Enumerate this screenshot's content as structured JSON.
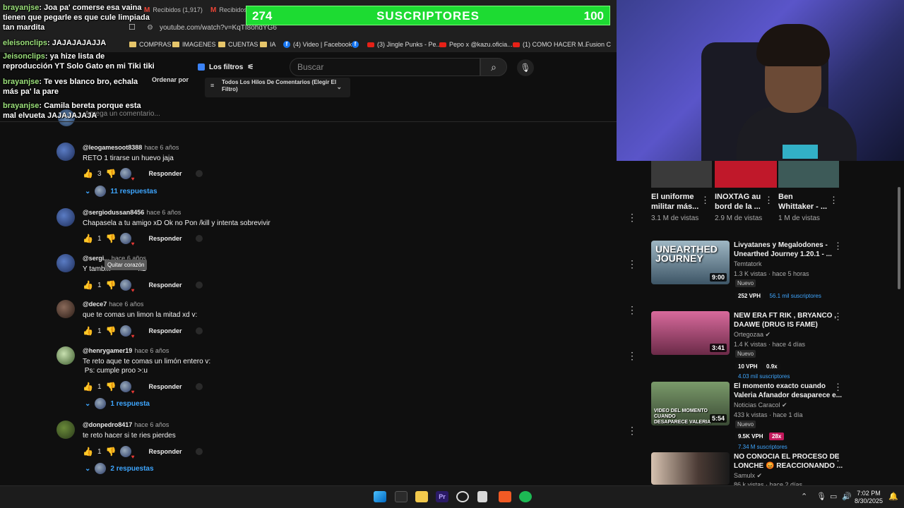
{
  "browser": {
    "tabs": [
      {
        "label": "Recibidos (1,917)"
      },
      {
        "label": "Recibidos"
      }
    ],
    "url": "youtube.com/watch?v=KqTI8ohdYG6",
    "bookmarks": [
      {
        "label": "COMPRAS",
        "icon": "folder-icon"
      },
      {
        "label": "IMAGENES",
        "icon": "folder-icon"
      },
      {
        "label": "CUENTAS",
        "icon": "folder-icon"
      },
      {
        "label": "IA",
        "icon": "folder-icon"
      },
      {
        "label": "(4) Video | Facebook",
        "icon": "facebook-icon"
      },
      {
        "label": "(3) Jingle Punks - Pe...",
        "icon": "youtube-icon"
      },
      {
        "label": "Pepo x @kazu.oficia...",
        "icon": "youtube-icon"
      },
      {
        "label": "(1) COMO HACER M...",
        "icon": "youtube-icon"
      },
      {
        "label": "Fusion C",
        "icon": "web-icon"
      }
    ]
  },
  "youtube": {
    "filters_label": "Los filtros",
    "search_placeholder": "Buscar",
    "sort_label": "Ordenar por",
    "threads_dropdown": "Todos Los Hilos De Comentarios (Elegir El Filtro)",
    "add_comment_placeholder": "Agrega un comentario...",
    "reply_label": "Responder",
    "tooltip": "Quitar corazón"
  },
  "comments": [
    {
      "user": "@leogamesoot8388",
      "time": "hace 6 años",
      "text": "RETO 1 tirarse un huevo jaja",
      "likes": "3",
      "replies": "11 respuestas"
    },
    {
      "user": "@sergiodussan8456",
      "time": "hace 6 años",
      "text": "Chapasela a tu amigo xD Ok no Pon /kill y intenta sobrevivir",
      "likes": "1",
      "replies": ""
    },
    {
      "user": "@sergi...",
      "time": "hace 6 años",
      "text": "Y tamb...              xD",
      "likes": "1",
      "replies": ""
    },
    {
      "user": "@dece7",
      "time": "hace 6 años",
      "text": "que te comas un limon la mitad xd v:",
      "likes": "1",
      "replies": ""
    },
    {
      "user": "@henrygamer19",
      "time": "hace 6 años",
      "text": "Te reto aque te comas un limón entero v:\n Ps: cumple proo >:u",
      "likes": "1",
      "replies": "1 respuesta"
    },
    {
      "user": "@donpedro8417",
      "time": "hace 6 años",
      "text": "te reto hacer si te ries pierdes",
      "likes": "1",
      "replies": "2 respuestas"
    }
  ],
  "chat": [
    {
      "user": "brayanjse",
      "text": "Joa pa' comerse esa vaina\ntienen que pegarle es que cule limpiada\ntan mardita"
    },
    {
      "user": "eleisonclips",
      "text": "JAJAJAJAJJA"
    },
    {
      "user": "Jeisonclips",
      "text": "ya hize lista de\nreproducción YT Solo Gato en mi Tiki tiki"
    },
    {
      "user": "brayanjse",
      "text": "Te ves blanco bro, echala"
    },
    {
      "user": "",
      "text": "más pa' la pare"
    },
    {
      "user": "brayanjse",
      "text": "Camila bereta porque esta\nmal elvueta JAJAJAJAJA"
    }
  ],
  "subscriber_goal": {
    "current": 274,
    "label": "SUSCRIPTORES",
    "goal": 100,
    "progress": 1.0,
    "color": "#22e53a"
  },
  "shorts": [
    {
      "title": "El uniforme\nmilitar más...",
      "views": "3.1 M de vistas"
    },
    {
      "title": "INOXTAG au\nbord de la ...",
      "views": "2.9 M de vistas"
    },
    {
      "title": "Ben\nWhittaker - ...",
      "views": "1 M de vistas"
    }
  ],
  "videos": [
    {
      "title": "Livyatanes y Megalodones -\nUnearthed Journey 1.20.1 - ...",
      "channel": "Temtatork",
      "meta": "1.3 K vistas · hace 5 horas",
      "new": "Nuevo",
      "duration": "9:00",
      "vph": "252 VPH",
      "subs": "56.1 mil suscriptores",
      "thumb_label": "UNEARTHED JOURNEY"
    },
    {
      "title": "NEW ERA FT RIK , BRYANCO ,\nDAAWE (DRUG IS FAME)",
      "channel": "Ortegozaa",
      "meta": "1.4 K vistas · hace 4 días",
      "new": "Nuevo",
      "duration": "3:41",
      "vph": "10 VPH",
      "mult": "0.9x",
      "subs": "4.03 mil suscriptores"
    },
    {
      "title": "El momento exacto cuando\nValeria Afanador desaparece e...",
      "channel": "Noticias Caracol",
      "meta": "433 k vistas · hace 1 día",
      "new": "Nuevo",
      "duration": "5:54",
      "vph": "9.5K VPH",
      "mult": "28x",
      "subs": "7.34 M suscriptores",
      "thumb_label": "VIDEO DEL MOMENTO CUANDO DESAPARECE VALERIA AFAN"
    },
    {
      "title": "NO CONOCIA EL PROCESO DE\nLONCHE 😡 REACCIONANDO ...",
      "channel": "Samulx",
      "meta": "86 k vistas · hace 2 días"
    }
  ],
  "taskbar": {
    "time": "7:02 PM",
    "date": "8/30/2025"
  }
}
